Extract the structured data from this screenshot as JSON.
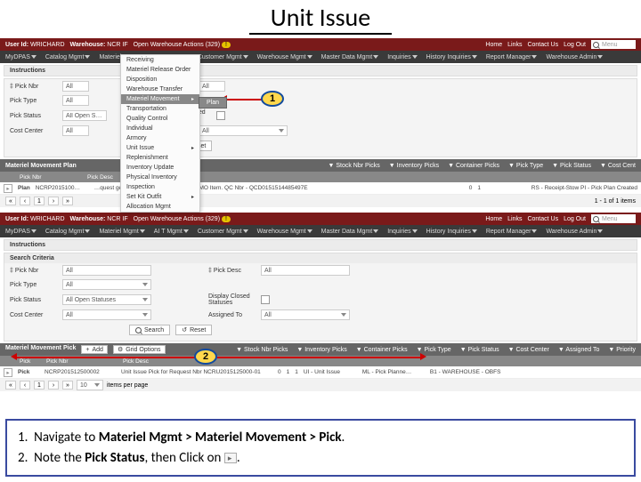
{
  "slide": {
    "title": "Unit Issue"
  },
  "header": {
    "user_label": "User Id:",
    "user": "WRICHARD",
    "wh_label": "Warehouse:",
    "wh": "NCR IF",
    "actions": "Open Warehouse Actions (329)",
    "right": {
      "home": "Home",
      "links": "Links",
      "contact": "Contact Us",
      "logout": "Log Out",
      "search_ph": "Menu"
    }
  },
  "nav": {
    "items": [
      "MyDPAS",
      "Catalog Mgmt",
      "Materiel Mgmt",
      "AI T Mgmt",
      "Customer Mgmt",
      "Warehouse Mgmt",
      "Master Data Mgmt",
      "Inquiries",
      "History Inquiries",
      "Report Manager",
      "Warehouse Admin"
    ]
  },
  "criteria": {
    "title": "Search Criteria",
    "instructions": "Instructions",
    "pick_nbr_lbl": "‡ Pick Nbr",
    "pick_nbr_val": "All",
    "pick_desc_lbl": "‡ Pick Desc",
    "pick_desc_val": "All",
    "pick_type_lbl": "Pick Type",
    "pick_type_val": "All",
    "pick_status_lbl": "Pick Status",
    "pick_status_val": "All Open Statuses",
    "cost_center_lbl": "Cost Center",
    "cost_center_val": "All",
    "dcs_lbl": "Display Closed Statuses",
    "assigned_lbl": "Assigned To",
    "assigned_val": "All",
    "search_btn": "Search",
    "reset_btn": "Reset"
  },
  "menu": {
    "items": [
      "Receiving",
      "Materiel Release Order",
      "Disposition",
      "Warehouse Transfer",
      "Materiel Movement",
      "Transportation",
      "Quality Control",
      "Individual",
      "Armory",
      "Unit Issue",
      "Replenishment",
      "Inventory Update",
      "Physical Inventory",
      "Inspection",
      "Set Kit Outfit",
      "Allocation Mgmt"
    ],
    "selected_index": 4,
    "flyout": "Plan"
  },
  "grid1": {
    "title": "Materiel Movement Plan",
    "filters": [
      "Stock Nbr Picks",
      "Inventory Picks",
      "Container Picks",
      "Pick Type",
      "Pick Status",
      "Cost Cent"
    ],
    "cols": [
      "",
      "Pick Nbr",
      "Pick Desc"
    ],
    "row": {
      "pick_nbr": "NCRP2015100…",
      "desc": "…quest generated from QC completed SMO Item. QC Nbr - QCD0151514485497E",
      "a": "0",
      "b": "1",
      "badge": "RS - Receipt-Stow   PI - Pick Plan Created"
    },
    "footer": {
      "page": "1",
      "summary": "1 - 1 of 1 items"
    }
  },
  "grid2": {
    "title": "Materiel Movement Pick",
    "add": "Add",
    "grid_opts": "Grid Options",
    "filters": [
      "Stock Nbr Picks",
      "Inventory Picks",
      "Container Picks",
      "Pick Type",
      "Pick Status",
      "Cost Center",
      "Assigned To",
      "Priority"
    ],
    "cols": [
      "",
      "Pick",
      "Pick Nbr",
      "Pick Desc"
    ],
    "row": {
      "pick_nbr": "NCRP201512500002",
      "desc": "Unit Issue Pick for Request Nbr NCRU2015125000-01",
      "a": "0",
      "b": "1",
      "c": "1",
      "type": "UI - Unit Issue",
      "status": "ML - Pick Planne…",
      "loc": "B1 - WAREHOUSE - OBFS"
    },
    "footer": {
      "page": "1",
      "per": "10",
      "per_lbl": "items per page"
    }
  },
  "callouts": {
    "c1": "1",
    "c2": "2"
  },
  "instructions": {
    "l1a": "Navigate to ",
    "l1b": "Materiel Mgmt > Materiel Movement > Pick",
    "l1c": ".",
    "l2a": "Note the ",
    "l2b": "Pick Status",
    "l2c": ", then Click on ",
    "l2d": "."
  }
}
